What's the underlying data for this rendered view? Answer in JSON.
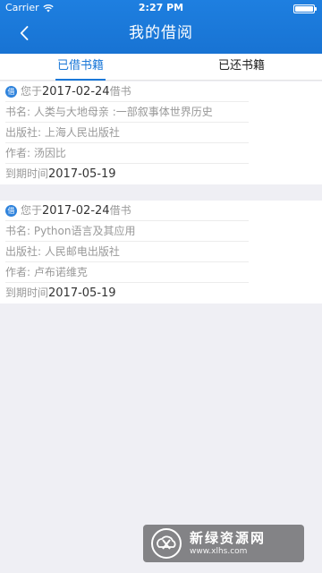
{
  "status_bar": {
    "carrier": "Carrier",
    "time": "2:27 PM"
  },
  "header": {
    "title": "我的借阅"
  },
  "tabs": [
    {
      "label": "已借书籍",
      "active": true
    },
    {
      "label": "已还书籍",
      "active": false
    }
  ],
  "borrowings": [
    {
      "badge": "借",
      "borrow_prefix": "您于",
      "borrow_date": "2017-02-24",
      "borrow_suffix": "借书",
      "title_label": "书名:",
      "title": "人类与大地母亲 :一部叙事体世界历史",
      "publisher_label": "出版社:",
      "publisher": "上海人民出版社",
      "author_label": "作者:",
      "author": "汤因比",
      "due_label": "到期时间",
      "due_date": "2017-05-19"
    },
    {
      "badge": "借",
      "borrow_prefix": "您于",
      "borrow_date": "2017-02-24",
      "borrow_suffix": "借书",
      "title_label": "书名:",
      "title": "Python语言及其应用",
      "publisher_label": "出版社:",
      "publisher": "人民邮电出版社",
      "author_label": "作者:",
      "author": "卢布诺维克",
      "due_label": "到期时间",
      "due_date": "2017-05-19"
    }
  ],
  "watermark": {
    "title": "新绿资源网",
    "url": "www.xlhs.com"
  },
  "colors": {
    "header_blue": "#1b78d8",
    "background": "#efeff4"
  }
}
